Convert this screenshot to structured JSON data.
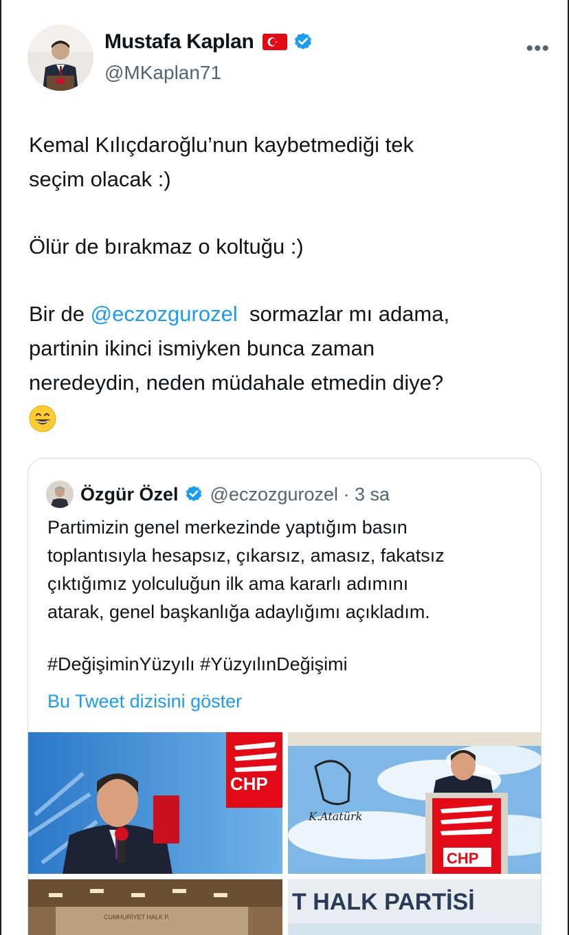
{
  "author": {
    "name": "Mustafa Kaplan",
    "handle": "@MKaplan71",
    "more": "•••"
  },
  "tweet": {
    "para1_line1": "Kemal Kılıçdaroğlu’nun kaybetmediği tek",
    "para1_line2": "seçim olacak :)",
    "para2": "Ölür de bırakmaz o koltuğu :)",
    "para3_prefix": "Bir de ",
    "para3_mention": "@eczozgurozel",
    "para3_suffix": "  sormazlar mı adama,",
    "para3_line2": "partinin ikinci ismiyken bunca zaman",
    "para3_line3": "neredeydin, neden müdahale etmedin diye?"
  },
  "quoted": {
    "name": "Özgür Özel",
    "handle_time": "@eczozgurozel · 3 sa",
    "line1": "Partimizin genel merkezinde yaptığım basın",
    "line2": "toplantısıyla hesapsız, çıkarsız, amasız, fakatsız",
    "line3": "çıktığımız yolculuğun ilk ama kararlı adımını",
    "line4": "atarak, genel başkanlığa adaylığımı açıkladım.",
    "hashtags": "#DeğişiminYüzyılı #YüzyılınDeğişimi",
    "show_thread": "Bu Tweet dizisini göster",
    "images": {
      "img1_logo": "CHP",
      "img2_logo": "CHP",
      "img2_signature": "K.Atatürk",
      "img4_banner": "T  HALK  PARTİSİ",
      "img3_sign": "CUMHURİYET HALK P."
    }
  },
  "colors": {
    "accent": "#1d9bf0",
    "secondary": "#536471",
    "chp_red": "#e30a17"
  }
}
